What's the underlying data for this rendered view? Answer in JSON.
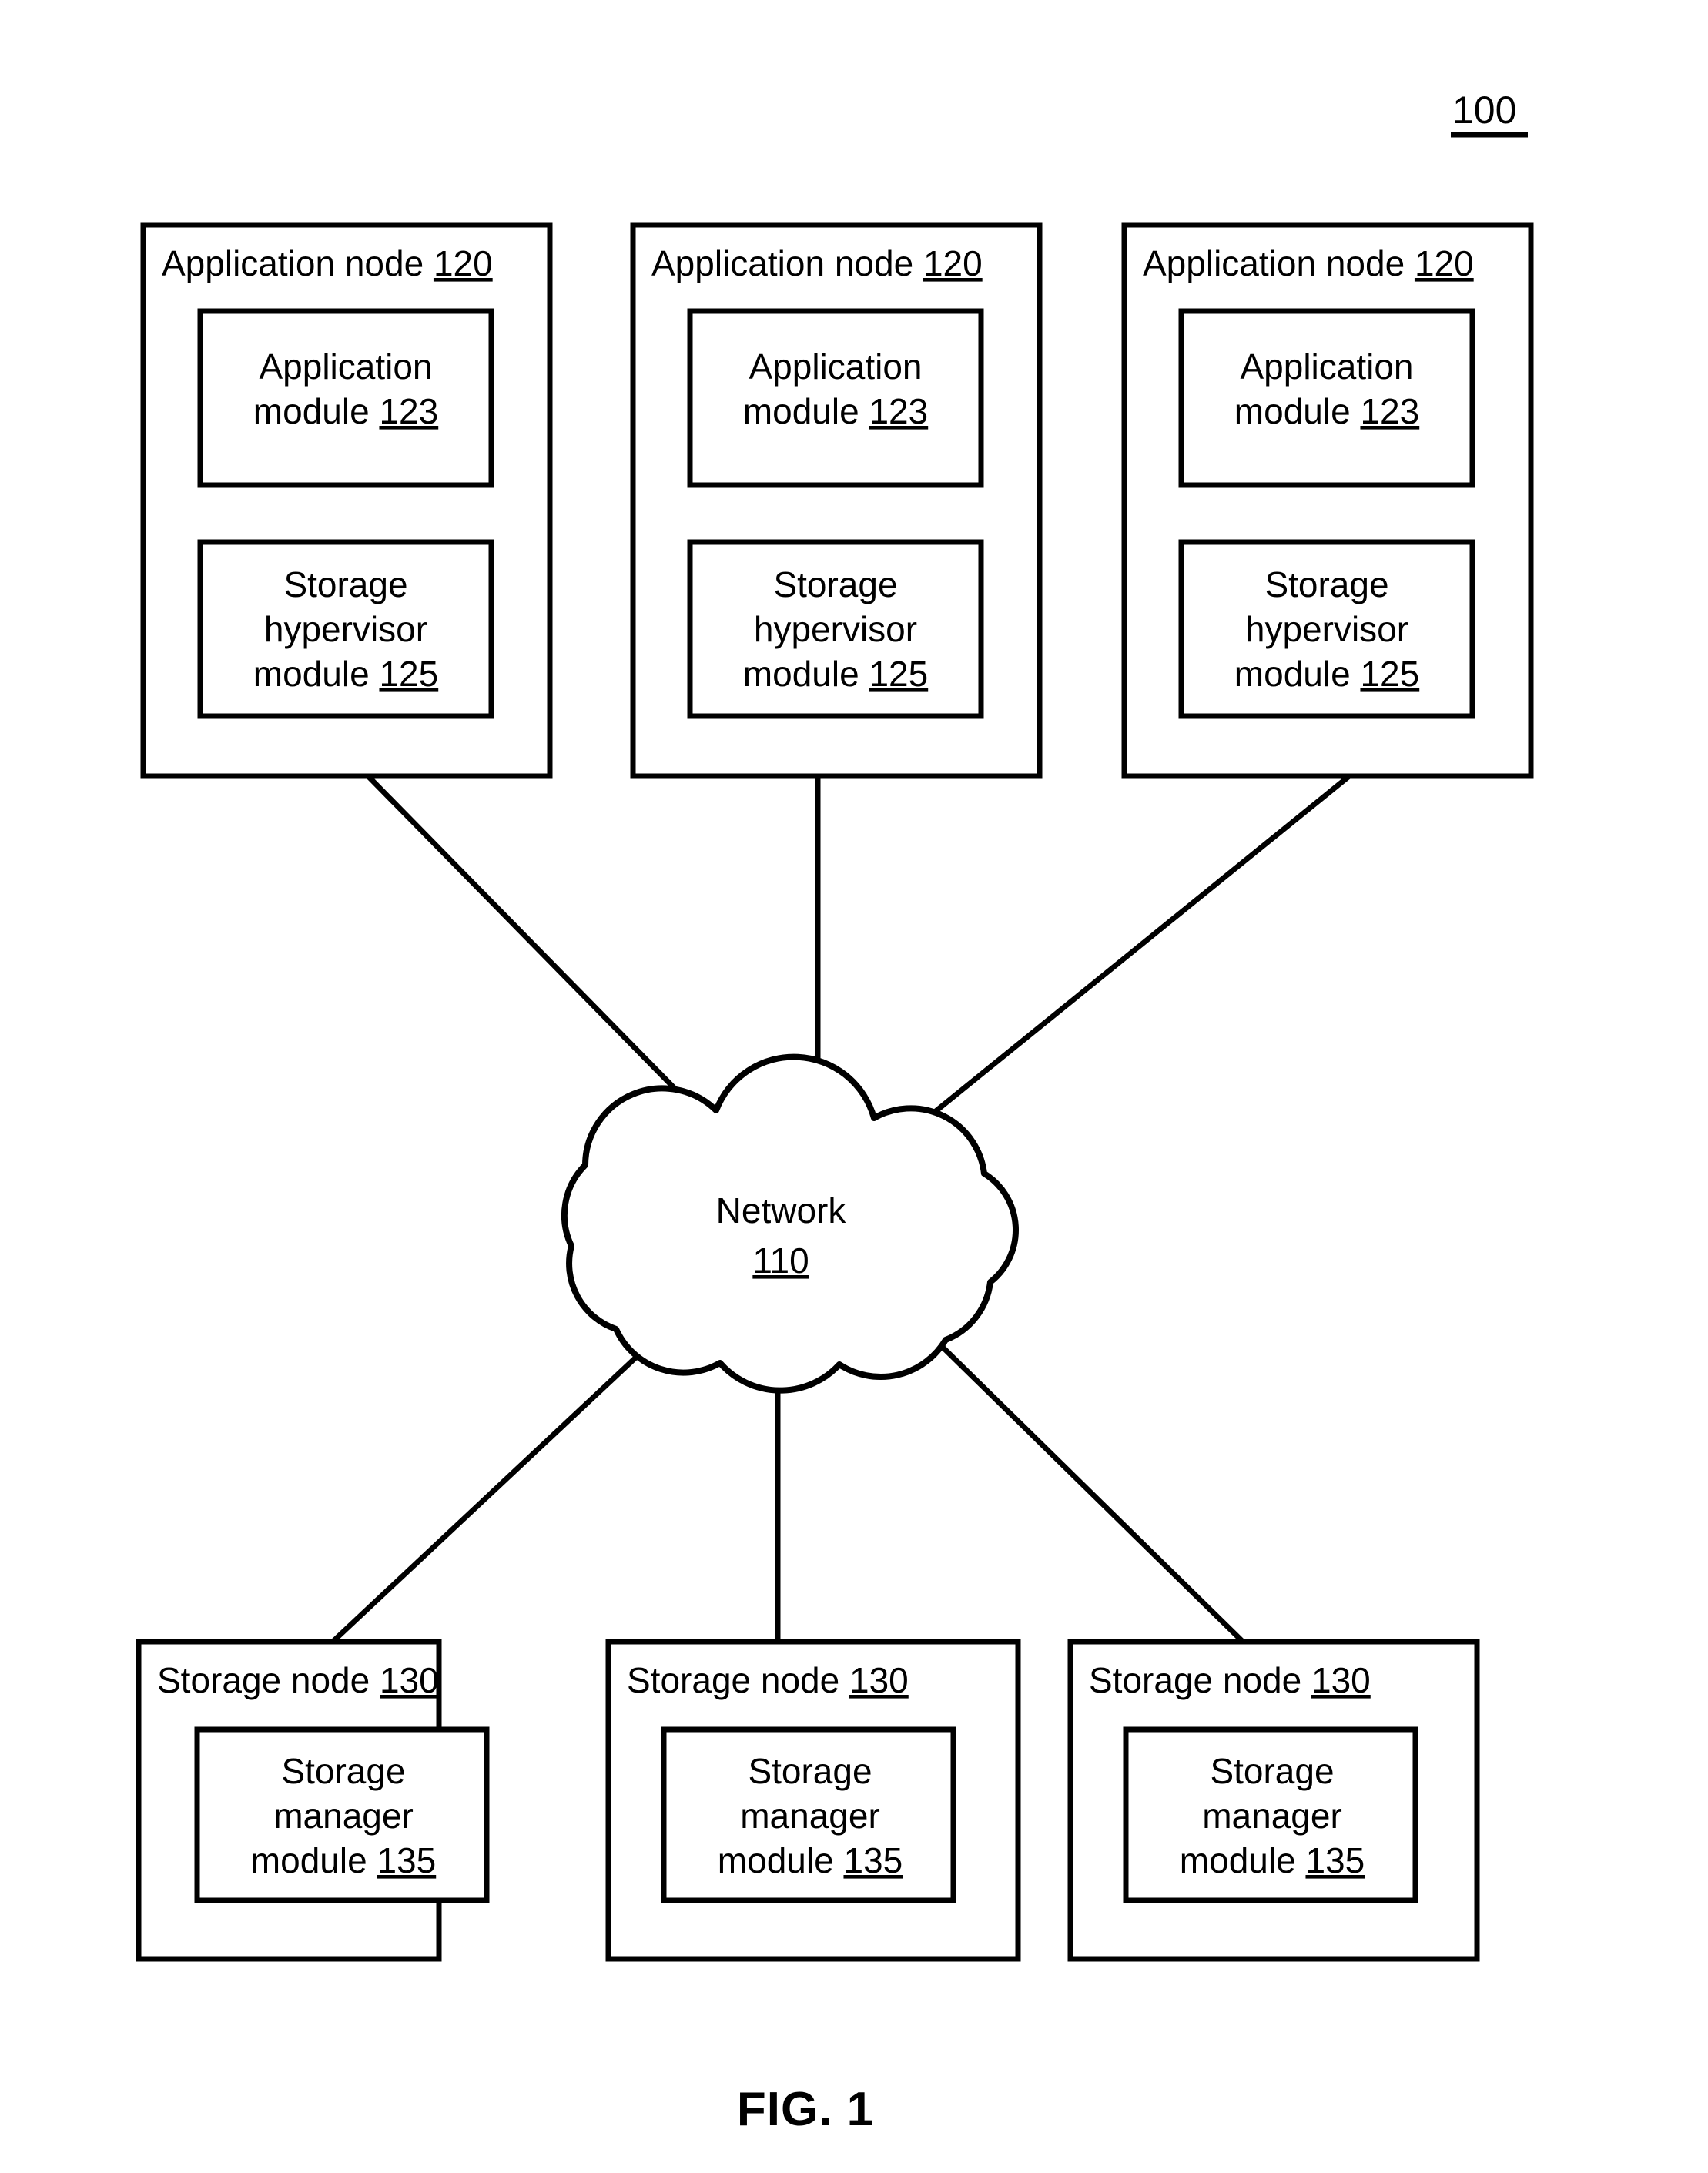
{
  "figure": {
    "number_label": "100",
    "caption": "FIG. 1"
  },
  "network": {
    "name": "Network",
    "ref": "110",
    "icon": "cloud-icon"
  },
  "application_nodes": [
    {
      "title": "Application node",
      "ref": "120",
      "modules": [
        {
          "lines": [
            "Application",
            "module"
          ],
          "ref": "123",
          "name": "application-module"
        },
        {
          "lines": [
            "Storage",
            "hypervisor",
            "module"
          ],
          "ref": "125",
          "name": "storage-hypervisor-module"
        }
      ]
    },
    {
      "title": "Application node",
      "ref": "120",
      "modules": [
        {
          "lines": [
            "Application",
            "module"
          ],
          "ref": "123",
          "name": "application-module"
        },
        {
          "lines": [
            "Storage",
            "hypervisor",
            "module"
          ],
          "ref": "125",
          "name": "storage-hypervisor-module"
        }
      ]
    },
    {
      "title": "Application node",
      "ref": "120",
      "modules": [
        {
          "lines": [
            "Application",
            "module"
          ],
          "ref": "123",
          "name": "application-module"
        },
        {
          "lines": [
            "Storage",
            "hypervisor",
            "module"
          ],
          "ref": "125",
          "name": "storage-hypervisor-module"
        }
      ]
    }
  ],
  "storage_nodes": [
    {
      "title": "Storage node",
      "ref": "130",
      "modules": [
        {
          "lines": [
            "Storage",
            "manager",
            "module"
          ],
          "ref": "135",
          "name": "storage-manager-module"
        }
      ]
    },
    {
      "title": "Storage node",
      "ref": "130",
      "modules": [
        {
          "lines": [
            "Storage",
            "manager",
            "module"
          ],
          "ref": "135",
          "name": "storage-manager-module"
        }
      ]
    },
    {
      "title": "Storage node",
      "ref": "130",
      "modules": [
        {
          "lines": [
            "Storage",
            "manager",
            "module"
          ],
          "ref": "135",
          "name": "storage-manager-module"
        }
      ]
    }
  ],
  "colors": {
    "stroke": "#000000",
    "background": "#ffffff"
  }
}
